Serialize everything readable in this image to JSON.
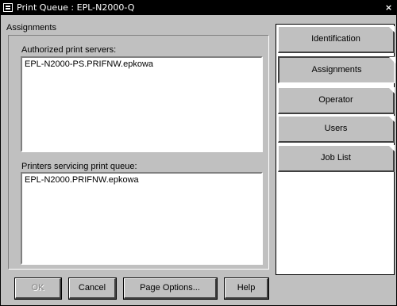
{
  "window": {
    "title": "Print Queue : EPL-N2000-Q",
    "close_label": "×"
  },
  "assignments": {
    "group_label": "Assignments",
    "servers_label": "Authorized print servers:",
    "servers": [
      "EPL-N2000-PS.PRIFNW.epkowa"
    ],
    "printers_label": "Printers servicing print queue:",
    "printers": [
      "EPL-N2000.PRIFNW.epkowa"
    ]
  },
  "tabs": [
    {
      "label": "Identification",
      "selected": false
    },
    {
      "label": "Assignments",
      "selected": true
    },
    {
      "label": "Operator",
      "selected": false
    },
    {
      "label": "Users",
      "selected": false
    },
    {
      "label": "Job List",
      "selected": false
    }
  ],
  "buttons": {
    "ok": "OK",
    "cancel": "Cancel",
    "page_options": "Page Options...",
    "help": "Help"
  }
}
